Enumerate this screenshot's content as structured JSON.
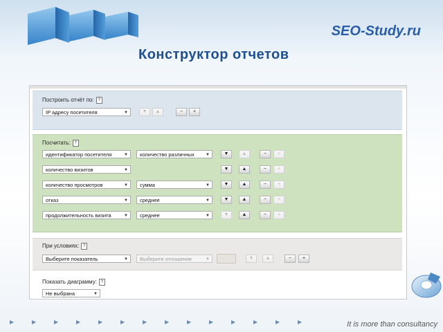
{
  "header": {
    "brand": "SEO-Study.ru",
    "title": "Конструктор отчетов"
  },
  "build": {
    "label": "Построить отчёт по:",
    "help": "?",
    "select": "IP адресу посетителя",
    "buttons": [
      "▼",
      "▲",
      "−",
      "+"
    ]
  },
  "count": {
    "label": "Посчитать:",
    "help": "?",
    "rows": [
      {
        "metric": "идентификатор посетителя",
        "func": "количество различных"
      },
      {
        "metric": "количество визитов",
        "func": ""
      },
      {
        "metric": "количество просмотров",
        "func": "сумма"
      },
      {
        "metric": "отказ",
        "func": "среднее"
      },
      {
        "metric": "продолжительность визита",
        "func": "среднее"
      }
    ]
  },
  "conditions": {
    "label": "При условиях:",
    "help": "?",
    "indicator": "Выберите показатель",
    "relation": "Выберите отношение"
  },
  "diagram": {
    "label": "Показать диаграмму:",
    "help": "?",
    "select": "Не выбрана"
  },
  "footer": {
    "tagline": "It is more than consultancy"
  },
  "colors": {
    "brand": "#2a5ea8",
    "title": "#1f4f93",
    "build_section": "#dce5ee",
    "count_section": "#cfe2bf",
    "cond_section": "#ebe9e7"
  },
  "icons": {
    "dropdown": "chevron-down-icon",
    "move_down": "arrow-down-icon",
    "move_up": "arrow-up-icon",
    "remove": "minus-icon",
    "add": "plus-icon",
    "help": "question-icon"
  }
}
